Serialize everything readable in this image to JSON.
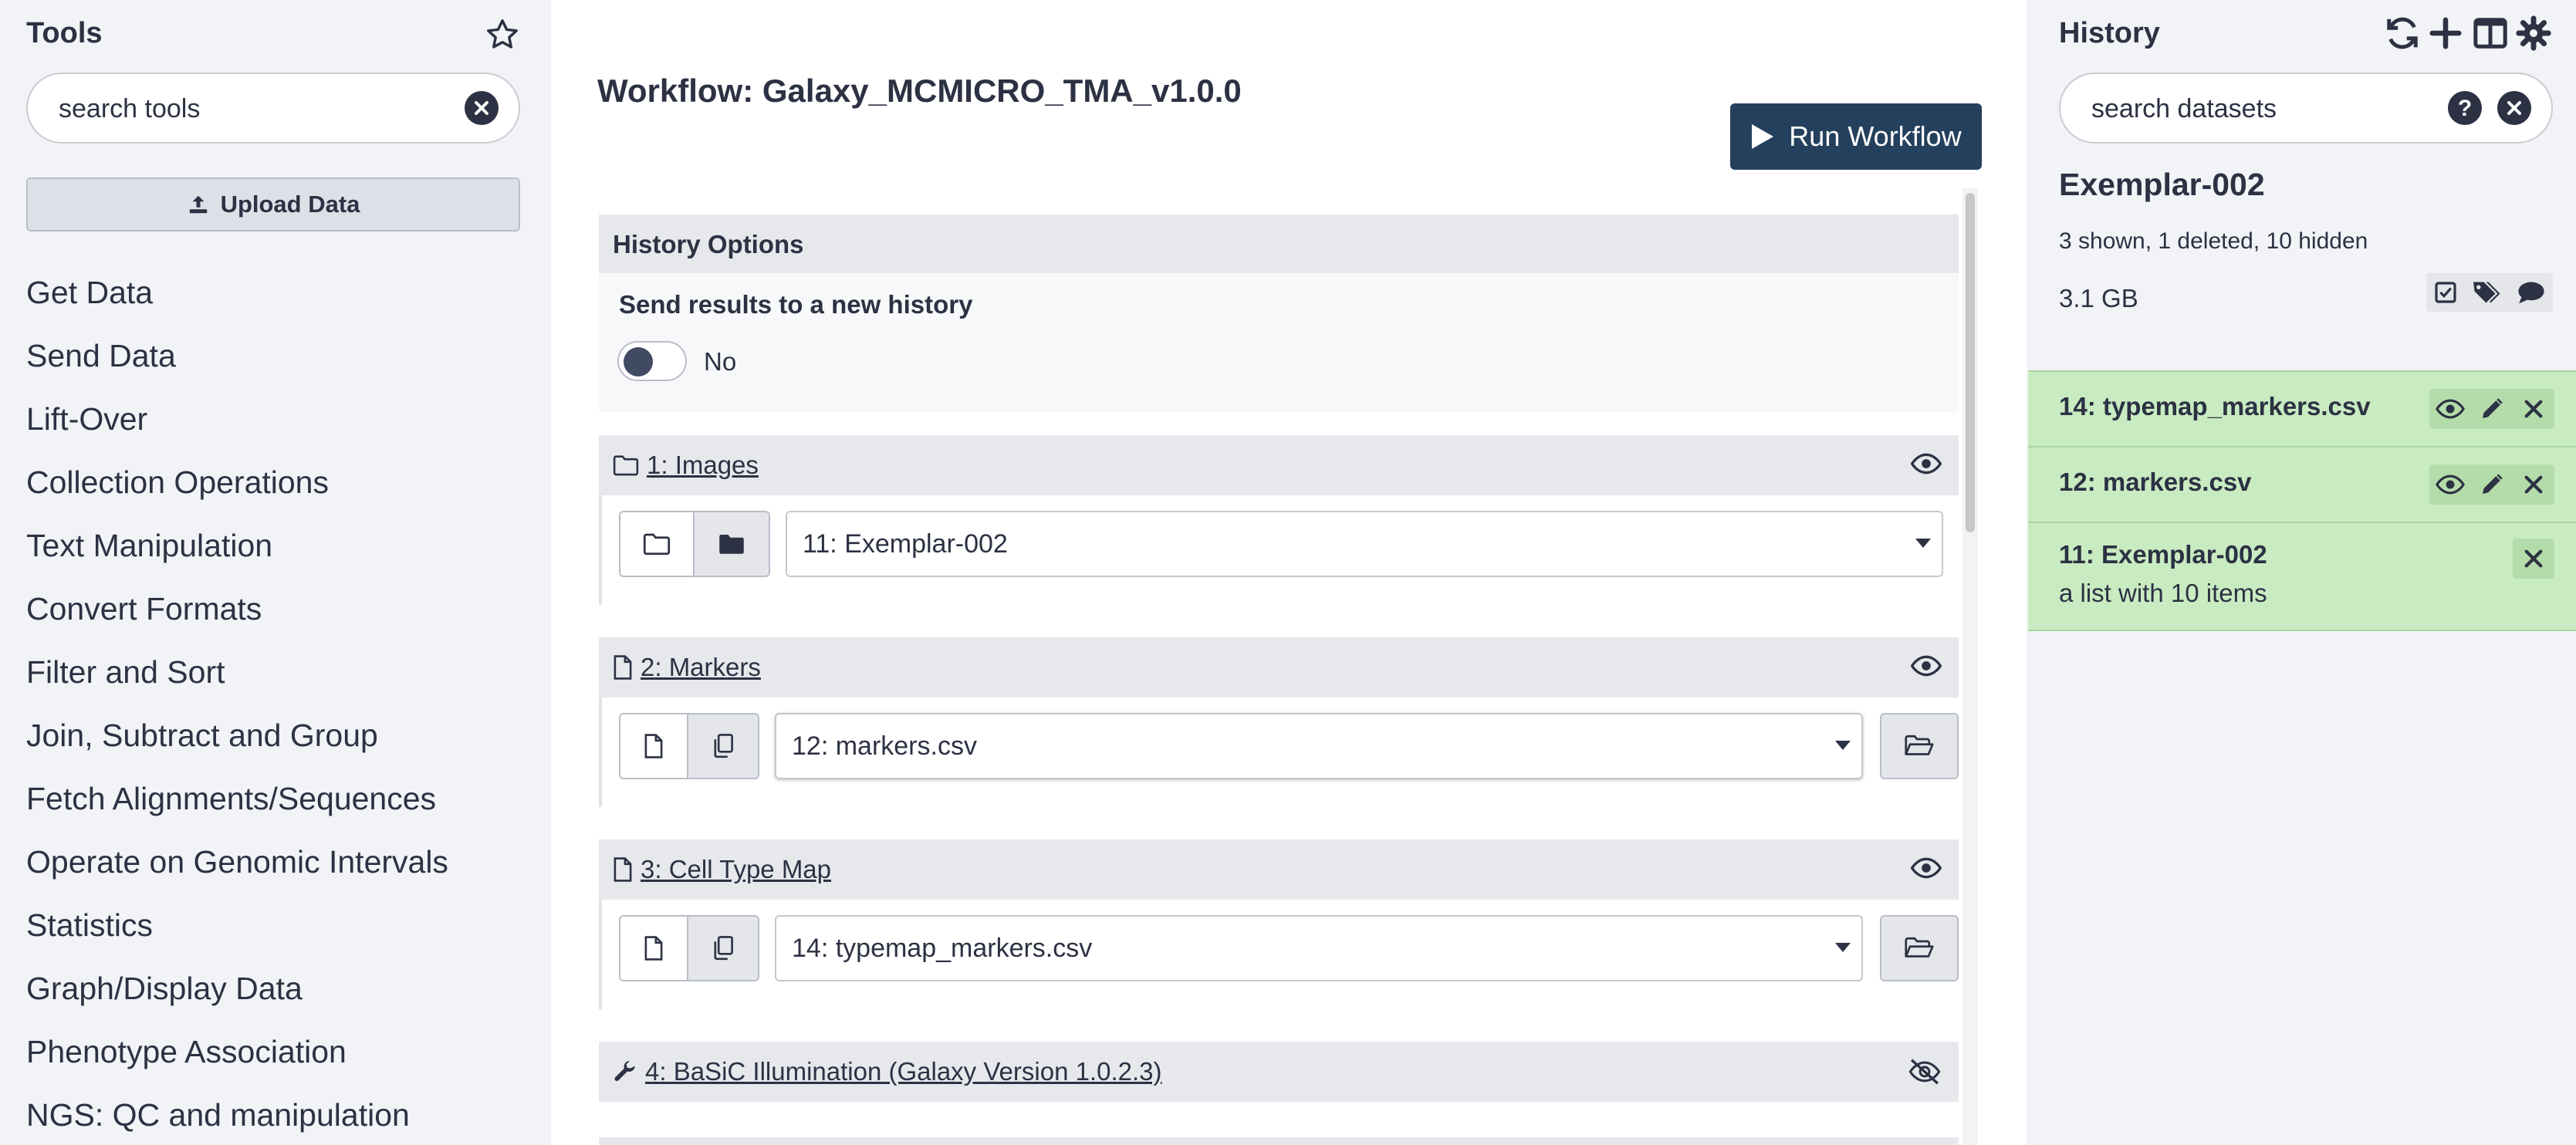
{
  "tool_panel": {
    "title": "Tools",
    "search_placeholder": "search tools",
    "upload_label": "Upload Data",
    "sections": [
      "Get Data",
      "Send Data",
      "Lift-Over",
      "Collection Operations",
      "Text Manipulation",
      "Convert Formats",
      "Filter and Sort",
      "Join, Subtract and Group",
      "Fetch Alignments/Sequences",
      "Operate on Genomic Intervals",
      "Statistics",
      "Graph/Display Data",
      "Phenotype Association",
      "NGS: QC and manipulation"
    ]
  },
  "workflow": {
    "title": "Workflow: Galaxy_MCMICRO_TMA_v1.0.0",
    "run_label": "Run Workflow",
    "history_options": {
      "heading": "History Options",
      "send_label": "Send results to a new history",
      "toggle_value": "No"
    },
    "steps": [
      {
        "label": "1: Images",
        "selected": "11: Exemplar-002"
      },
      {
        "label": "2: Markers",
        "selected": "12: markers.csv"
      },
      {
        "label": "3: Cell Type Map",
        "selected": "14: typemap_markers.csv"
      },
      {
        "label": "4: BaSiC Illumination (Galaxy Version 1.0.2.3)"
      }
    ]
  },
  "history": {
    "title": "History",
    "search_placeholder": "search datasets",
    "name": "Exemplar-002",
    "counts": "3 shown, 1 deleted, 10 hidden",
    "size": "3.1 GB",
    "datasets": [
      {
        "title": "14: typemap_markers.csv"
      },
      {
        "title": "12: markers.csv"
      },
      {
        "title": "11: Exemplar-002",
        "subtitle": "a list with 10 items"
      }
    ]
  },
  "colors": {
    "primary": "#24405c",
    "panel_bg": "#f2f3f6",
    "dataset_ok": "#c9ebc1",
    "text": "#2c3143"
  }
}
